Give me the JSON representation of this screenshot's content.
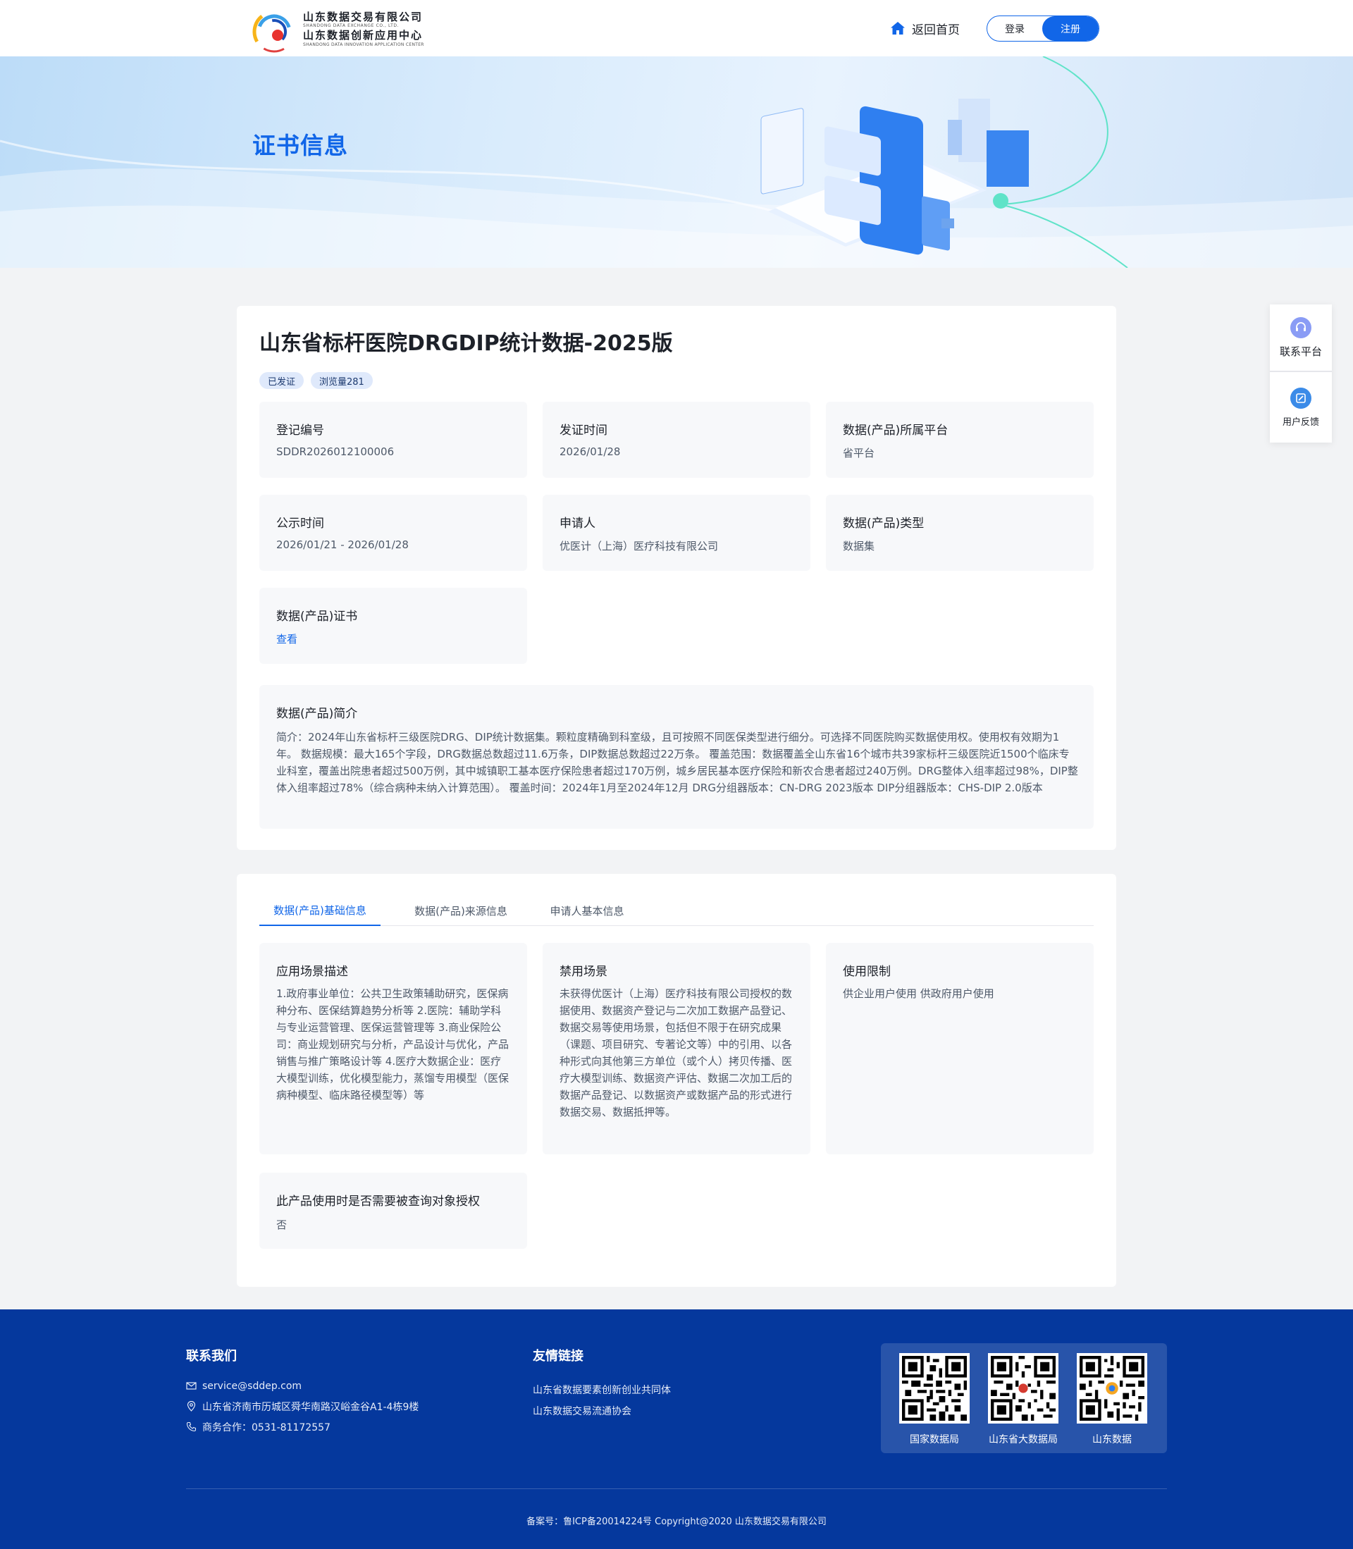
{
  "header": {
    "logo": {
      "cn_line1": "山东数据交易有限公司",
      "en_line1": "SHANDONG DATA EXCHANGE CO., LTD.",
      "cn_line2": "山东数据创新应用中心",
      "en_line2": "SHANDONG DATA INNOVATION APPLICATION CENTER"
    },
    "home_label": "返回首页",
    "login_label": "登录",
    "register_label": "注册",
    "accent_color": "#1166e8"
  },
  "banner": {
    "title": "证书信息"
  },
  "float_side": {
    "contact_label": "联系平台",
    "feedback_label": "用户反馈"
  },
  "product": {
    "title": "山东省标杆医院DRGDIP统计数据-2025版",
    "tags": [
      "已发证",
      "浏览量281"
    ],
    "fields": [
      {
        "label": "登记编号",
        "value": "SDDR2026012100006"
      },
      {
        "label": "发证时间",
        "value": "2026/01/28"
      },
      {
        "label": "数据(产品)所属平台",
        "value": "省平台"
      },
      {
        "label": "公示时间",
        "value": "2026/01/21 - 2026/01/28"
      },
      {
        "label": "申请人",
        "value": "优医计（上海）医疗科技有限公司"
      },
      {
        "label": "数据(产品)类型",
        "value": "数据集"
      },
      {
        "label": "数据(产品)证书",
        "value": "查看"
      }
    ],
    "intro": {
      "label": "数据(产品)简介",
      "text": "简介：2024年山东省标杆三级医院DRG、DIP统计数据集。颗粒度精确到科室级，且可按照不同医保类型进行细分。可选择不同医院购买数据使用权。使用权有效期为1年。 数据规模：最大165个字段，DRG数据总数超过11.6万条，DIP数据总数超过22万条。 覆盖范围：数据覆盖全山东省16个城市共39家标杆三级医院近1500个临床专业科室，覆盖出院患者超过500万例，其中城镇职工基本医疗保险患者超过170万例，城乡居民基本医疗保险和新农合患者超过240万例。DRG整体入组率超过98%，DIP整体入组率超过78%（综合病种未纳入计算范围）。 覆盖时间：2024年1月至2024年12月 DRG分组器版本：CN-DRG 2023版本 DIP分组器版本：CHS-DIP 2.0版本"
    }
  },
  "tabs": {
    "items": [
      "数据(产品)基础信息",
      "数据(产品)来源信息",
      "申请人基本信息"
    ],
    "active_index": 0,
    "panels": [
      {
        "label": "应用场景描述",
        "text": "1.政府事业单位：公共卫生政策辅助研究，医保病种分布、医保结算趋势分析等 2.医院：辅助学科与专业运营管理、医保运营管理等 3.商业保险公司：商业规划研究与分析，产品设计与优化，产品销售与推广策略设计等 4.医疗大数据企业：医疗大模型训练，优化模型能力，蒸馏专用模型（医保病种模型、临床路径模型等）等"
      },
      {
        "label": "禁用场景",
        "text": "未获得优医计（上海）医疗科技有限公司授权的数据使用、数据资产登记与二次加工数据产品登记、数据交易等使用场景，包括但不限于在研究成果（课题、项目研究、专著论文等）中的引用、以各种形式向其他第三方单位（或个人）拷贝传播、医疗大模型训练、数据资产评估、数据二次加工后的数据产品登记、以数据资产或数据产品的形式进行数据交易、数据抵押等。"
      },
      {
        "label": "使用限制",
        "text": "供企业用户使用 供政府用户使用"
      },
      {
        "label": "此产品使用时是否需要被查询对象授权",
        "text": "否"
      }
    ]
  },
  "footer": {
    "contact_title": "联系我们",
    "email": "service@sddep.com",
    "address": "山东省济南市历城区舜华南路汉峪金谷A1-4栋9楼",
    "phone": "商务合作：0531-81172557",
    "links_title": "友情链接",
    "links": [
      "山东省数据要素创新创业共同体",
      "山东数据交易流通协会"
    ],
    "qr_codes": [
      "国家数据局",
      "山东省大数据局",
      "山东数据"
    ],
    "copyright": "备案号：鲁ICP备20014224号 Copyright@2020 山东数据交易有限公司",
    "bg_color": "#05389d"
  }
}
